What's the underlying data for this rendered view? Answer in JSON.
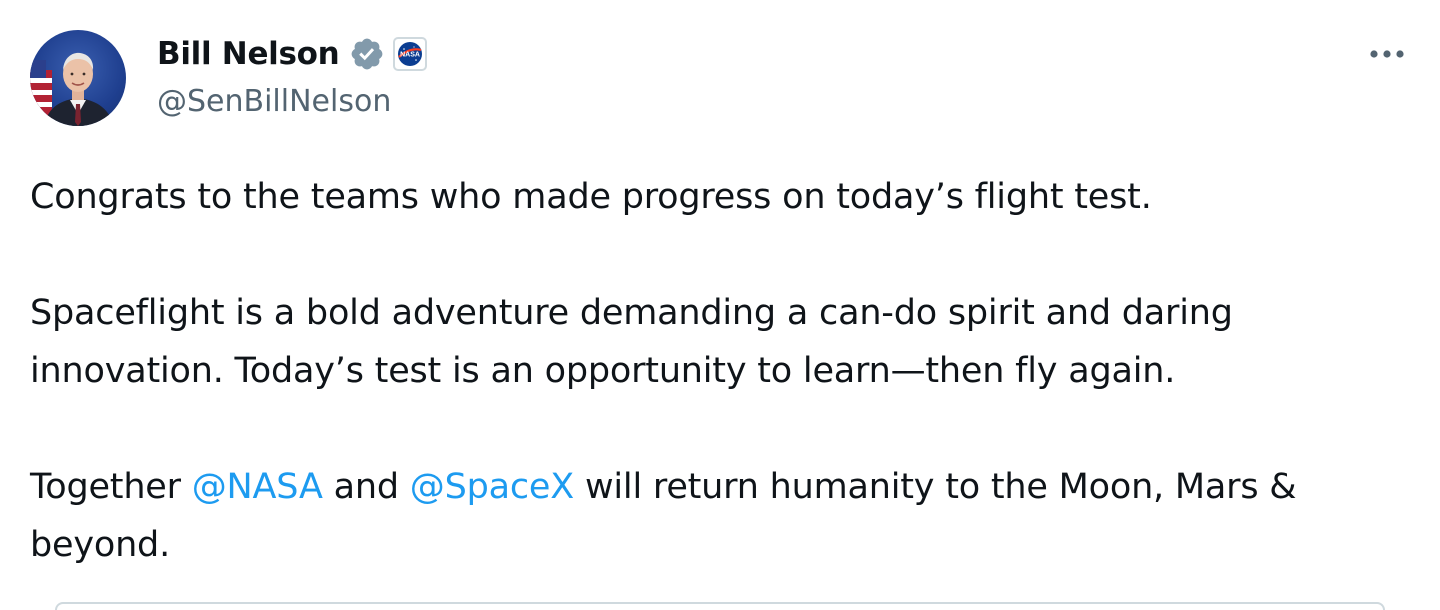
{
  "author": {
    "display_name": "Bill Nelson",
    "handle": "@SenBillNelson",
    "verified_icon": "verified-badge-icon",
    "affiliate_icon": "nasa-logo-icon",
    "affiliate_logo_text": "NASA"
  },
  "more_icon": "more-options-icon",
  "tweet": {
    "line1": "Congrats to the teams who made progress on today’s flight test.",
    "paragraph2_line1": "Spaceflight is a bold adventure demanding a can-do spirit and daring",
    "paragraph2_line2": "innovation. Today’s test is an opportunity to learn—then fly again.",
    "p3_prefix": "Together ",
    "mention1": "@NASA",
    "p3_middle": " and ",
    "mention2": "@SpaceX",
    "p3_suffix": " will return humanity to the Moon, Mars &",
    "p3_line2": "beyond."
  },
  "colors": {
    "link": "#1d9bf0",
    "verified": "#829aab",
    "secondary_text": "#536471",
    "primary_text": "#0f1419"
  }
}
